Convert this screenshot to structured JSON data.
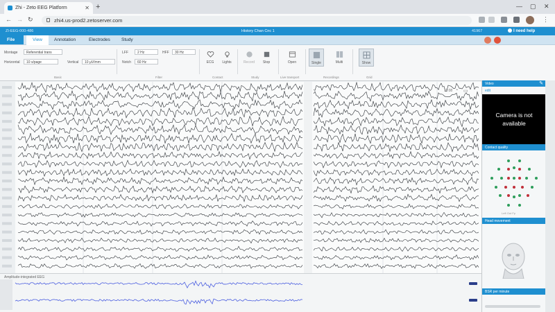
{
  "browser": {
    "tab_title": "Zhi - Zeto EEG Platform",
    "url": "zhi4.us-prod2.zetoserver.com"
  },
  "app": {
    "patient_id": "ZI-EEG-000-486",
    "session_title": "History Chan Cnc 1",
    "header_code": "41967",
    "help_label": "I need help"
  },
  "menu": {
    "items": [
      "File",
      "View",
      "Annotation",
      "Electrodes",
      "Study"
    ],
    "active": "View",
    "user_colors": [
      "#e07b5f",
      "#e0533c"
    ]
  },
  "ribbon": {
    "montage_label": "Montage",
    "montage_value": "Referential trans",
    "horizontal_label": "Horizontal",
    "horizontal_value": "10 s/page",
    "vertical_label": "Vertical",
    "vertical_value": "10 µV/mm",
    "lff_label": "LFF",
    "lff_value": "2 Hz",
    "hff_label": "HFF",
    "hff_value": "30 Hz",
    "notch_label": "Notch",
    "notch_value": "60 Hz",
    "buttons": [
      {
        "label": "ECG",
        "icon": "ecg-heart-icon"
      },
      {
        "label": "Lights",
        "icon": "lights-icon"
      },
      {
        "label": "Record",
        "icon": "record-icon"
      },
      {
        "label": "Stop",
        "icon": "stop-icon"
      },
      {
        "label": "Open",
        "icon": "open-icon"
      },
      {
        "label": "Single",
        "icon": "single-view-icon"
      },
      {
        "label": "Multi",
        "icon": "multi-view-icon"
      },
      {
        "label": "Show",
        "icon": "show-icon"
      }
    ],
    "groups": [
      "Basic",
      "Filter",
      "Contact",
      "Study",
      "Live transport",
      "Recordings",
      "Grid"
    ]
  },
  "eeg": {
    "channel_count": 22,
    "timestamp": "11:08"
  },
  "amplitude": {
    "title": "Amplitude-integrated EEG"
  },
  "right_panel": {
    "video_header": "Video",
    "video_sublabel": "edit",
    "camera_message": "Camera is not available",
    "contact_header": "Contact quality",
    "head_header": "Head movement",
    "rate_header": "BSR per minute",
    "contact_caption": "Left   Out  Fp"
  },
  "colors": {
    "accent": "#1e8fd0",
    "good_electrode": "#2e9e5b",
    "bad_electrode": "#c0303a"
  }
}
